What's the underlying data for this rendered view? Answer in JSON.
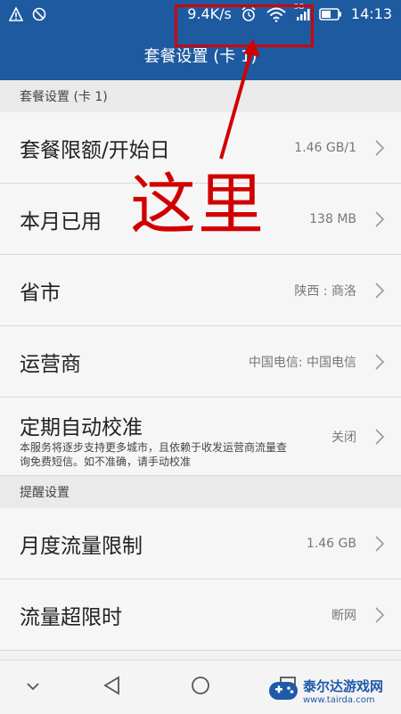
{
  "status_bar": {
    "speed": "9.4K/s",
    "time": "14:13",
    "network_type": "3G",
    "icons": [
      "warning-icon",
      "blocked-icon",
      "alarm-icon",
      "wifi-icon",
      "signal-icon",
      "battery-icon"
    ]
  },
  "title_bar": {
    "title": "套餐设置 (卡 1)"
  },
  "sections": {
    "plan": {
      "header": "套餐设置 (卡 1)"
    },
    "reminder": {
      "header": "提醒设置"
    }
  },
  "rows": {
    "limit": {
      "label": "套餐限额/开始日",
      "value": "1.46 GB/1"
    },
    "used": {
      "label": "本月已用",
      "value": "138 MB"
    },
    "province": {
      "label": "省市",
      "value": "陕西 : 商洛"
    },
    "carrier": {
      "label": "运营商",
      "value": "中国电信: 中国电信"
    },
    "calibrate": {
      "label": "定期自动校准",
      "desc": "本服务将逐步支持更多城市，且依赖于收发运营商流量查询免费短信。如不准确，请手动校准",
      "value": "关闭"
    },
    "monthly_limit": {
      "label": "月度流量限制",
      "value": "1.46 GB"
    },
    "over_limit": {
      "label": "流量超限时",
      "value": "断网"
    }
  },
  "annotation": {
    "text": "这里"
  },
  "watermark": {
    "name": "泰尔达游戏网",
    "url": "www.tairda.com"
  },
  "colors": {
    "header_blue": "#1e5aa0",
    "annotation_red": "#d10000"
  }
}
